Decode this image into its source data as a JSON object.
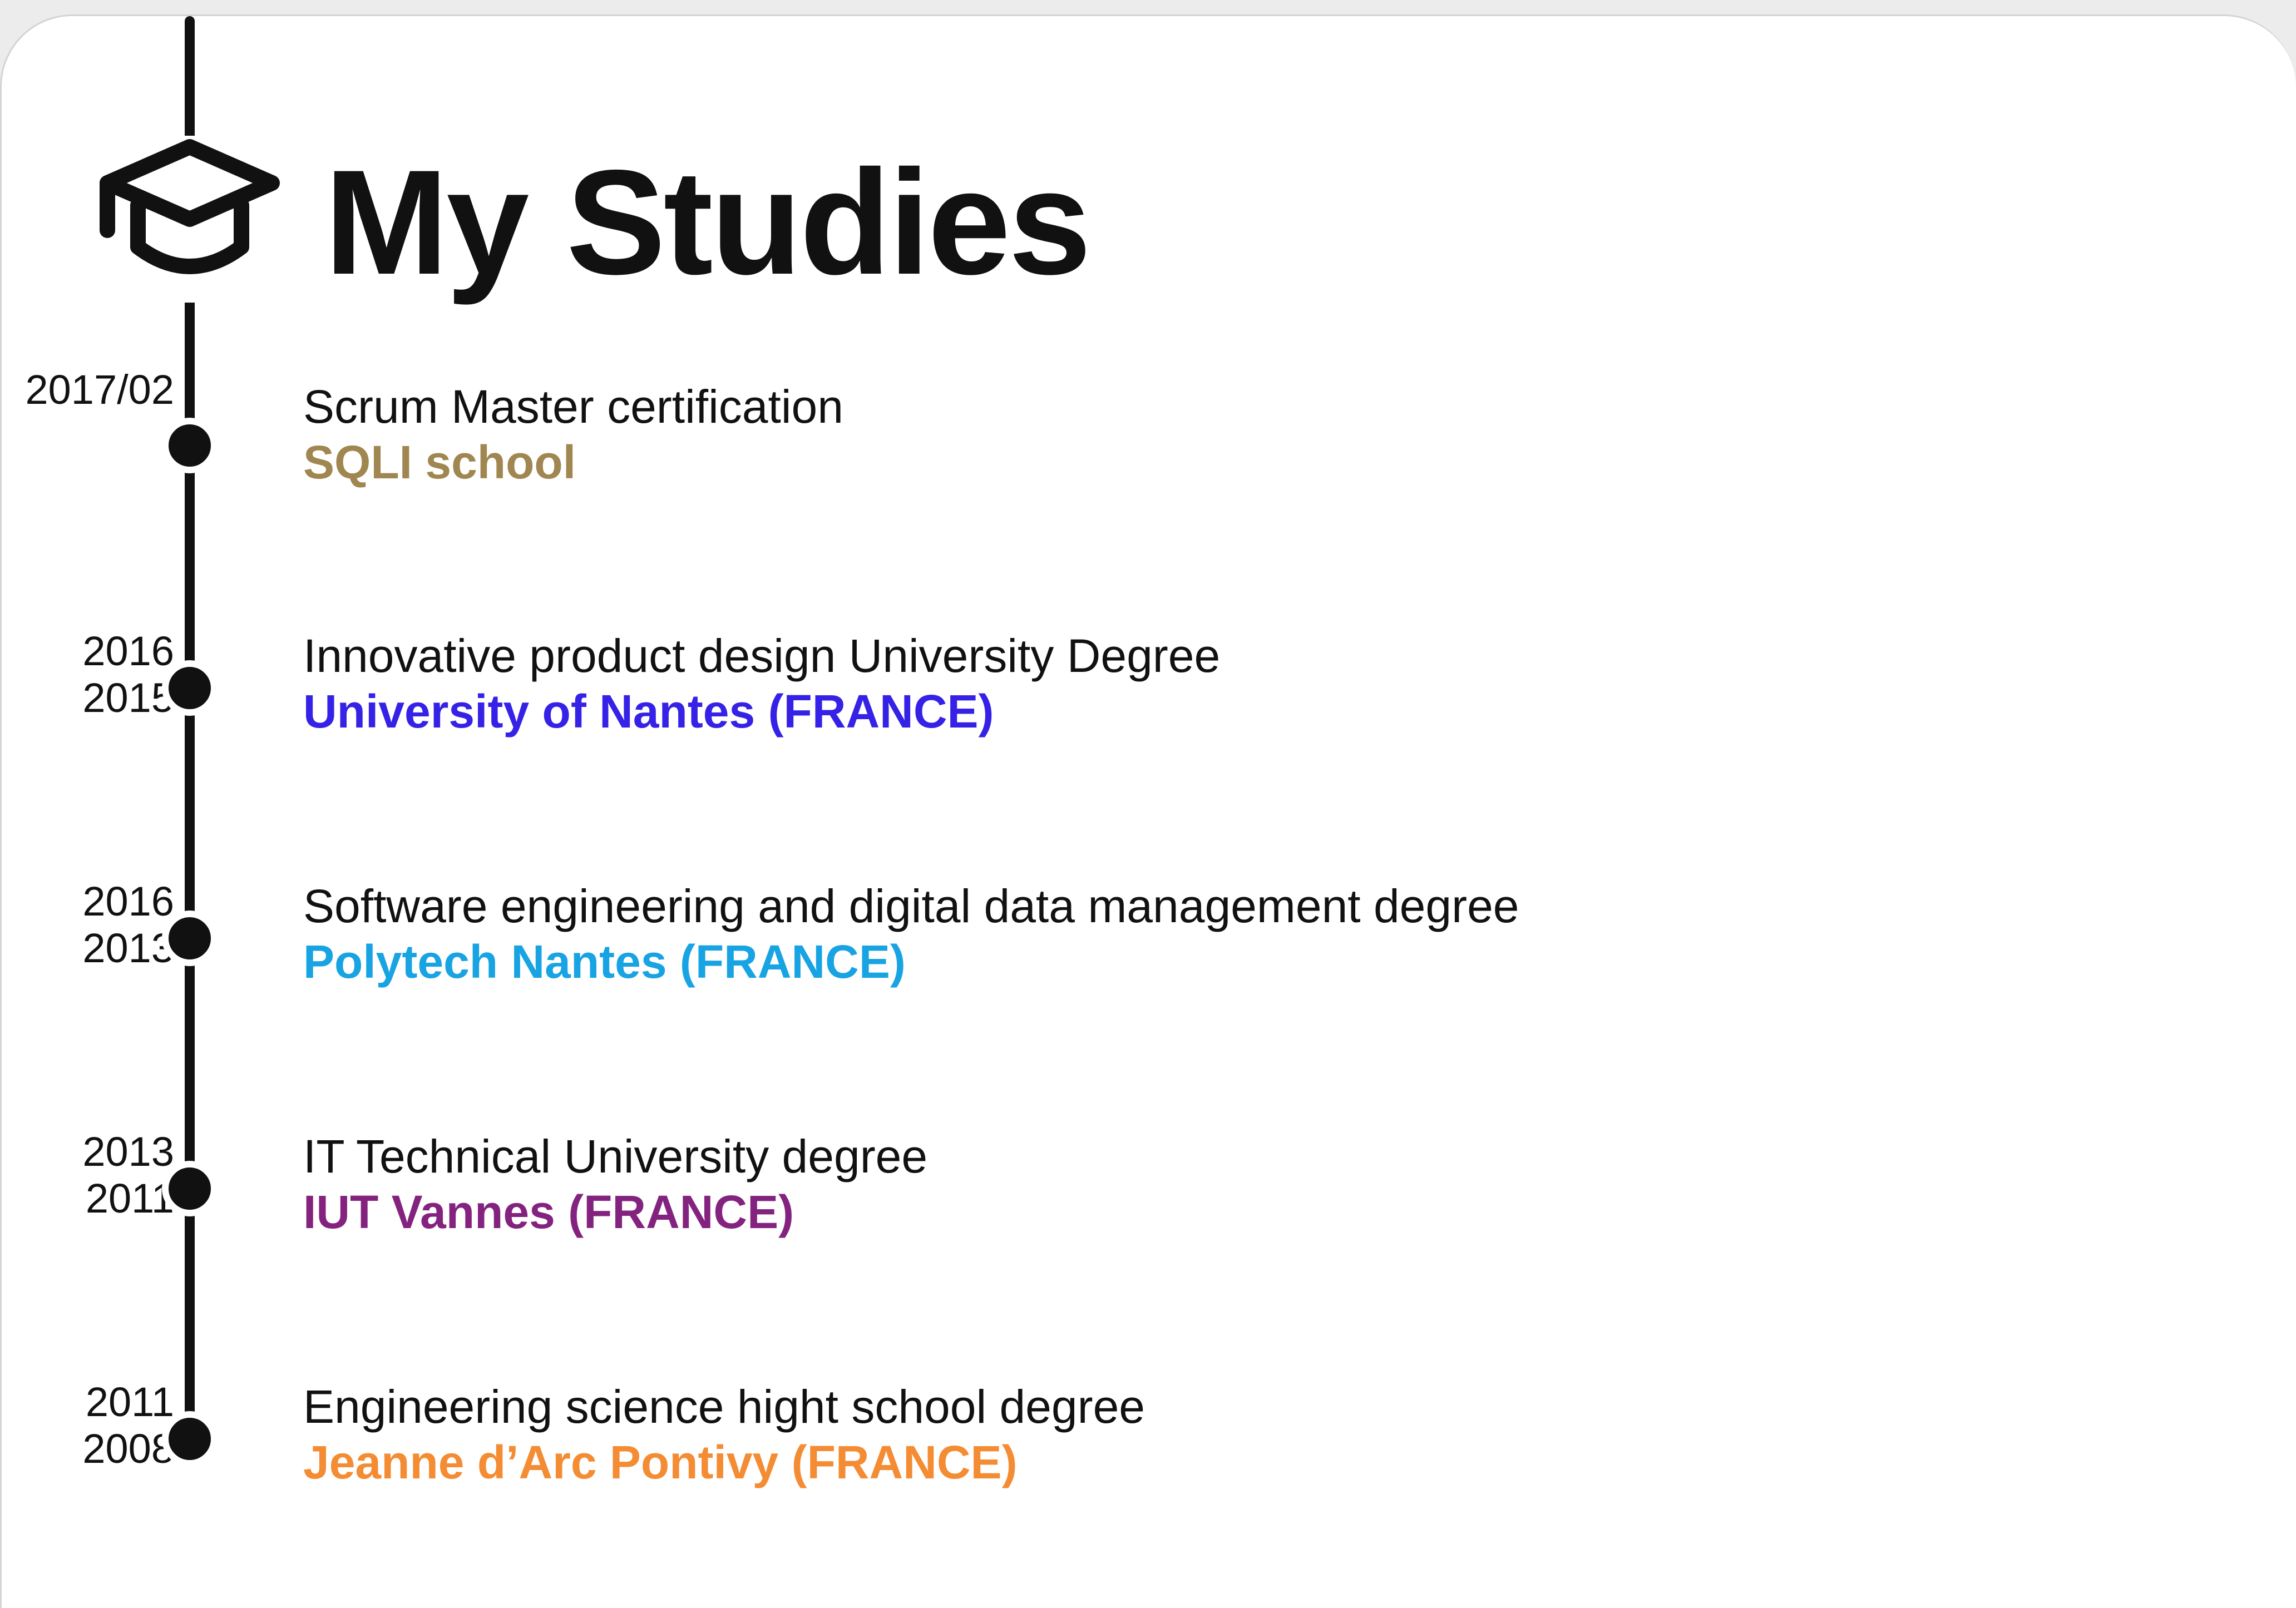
{
  "header": {
    "title": "My Studies",
    "icon": "graduation-cap-icon"
  },
  "entries": [
    {
      "date_top": "2017/02",
      "date_bottom": "",
      "title": "Scrum Master certification",
      "school": "SQLI school",
      "school_color": "#a08650"
    },
    {
      "date_top": "2016",
      "date_bottom": "2015",
      "title": "Innovative product design University Degree",
      "school": "University of Nantes (FRANCE)",
      "school_color": "#3522e6"
    },
    {
      "date_top": "2016",
      "date_bottom": "2013",
      "title": "Software engineering and digital data management degree",
      "school": "Polytech Nantes (FRANCE)",
      "school_color": "#18a3e3"
    },
    {
      "date_top": "2013",
      "date_bottom": "2011",
      "title": "IT Technical University degree",
      "school": "IUT Vannes (FRANCE)",
      "school_color": "#84237f"
    },
    {
      "date_top": "2011",
      "date_bottom": "2008",
      "title": "Engineering science hight school degree",
      "school": "Jeanne d’Arc Pontivy (FRANCE)",
      "school_color": "#f48c33"
    }
  ]
}
